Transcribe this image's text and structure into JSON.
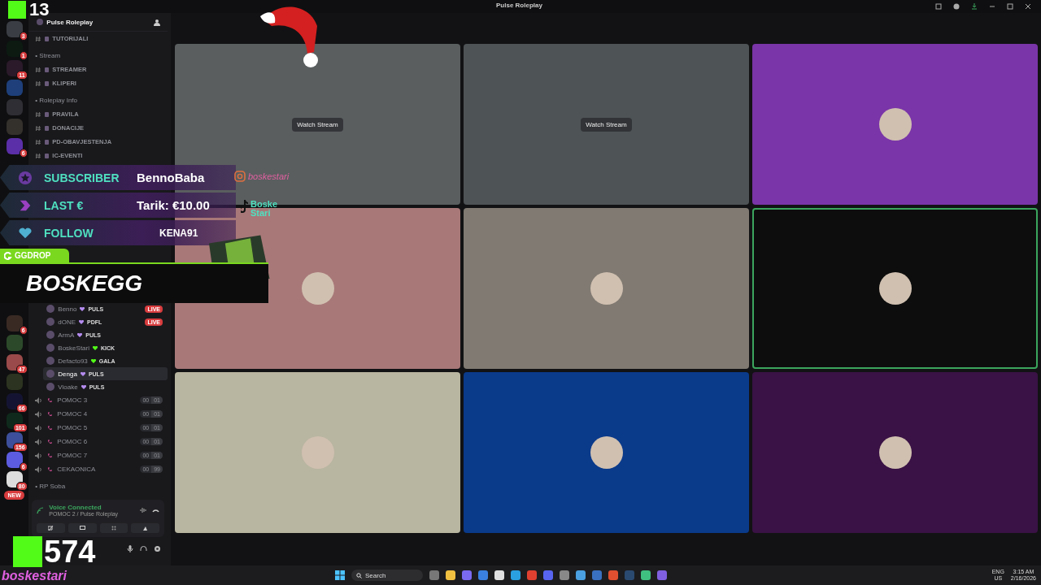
{
  "window": {
    "title": "Pulse Roleplay"
  },
  "server_rail": {
    "top": [
      {
        "color": "#3a3d44",
        "badge": "3"
      },
      {
        "color": "#0c1a12",
        "badge": "1"
      },
      {
        "color": "#2a1a2a",
        "badge": "11"
      },
      {
        "color": "#1e3f7a"
      },
      {
        "color": "#2e2e34"
      },
      {
        "color": "#34302c"
      },
      {
        "color": "#5b2fa8",
        "badge": "6"
      }
    ],
    "bottom": [
      {
        "color": "#3a2a24",
        "badge": "6"
      },
      {
        "color": "#2c4a2a"
      },
      {
        "color": "#9a4a4a",
        "badge": "47"
      },
      {
        "color": "#2c3320"
      },
      {
        "color": "#141432",
        "badge": "66"
      },
      {
        "color": "#0f2a1c",
        "badge": "101"
      },
      {
        "color": "#3d4f9a",
        "badge": "156"
      },
      {
        "color": "#5c5ce0",
        "badge": "6"
      },
      {
        "color": "#dddddd",
        "badge": "80"
      }
    ],
    "new_label": "NEW"
  },
  "sidebar": {
    "server_name": "Pulse Roleplay",
    "channels": [
      {
        "kind": "channel",
        "name": "TUTORIJALI"
      },
      {
        "kind": "category",
        "name": "• Stream"
      },
      {
        "kind": "channel",
        "name": "STREAMER"
      },
      {
        "kind": "channel",
        "name": "KLIPERI"
      },
      {
        "kind": "category",
        "name": "• Roleplay Info"
      },
      {
        "kind": "channel",
        "name": "PRAVILA"
      },
      {
        "kind": "channel",
        "name": "DONACIJE"
      },
      {
        "kind": "channel",
        "name": "PD-OBAVJESTENJA"
      },
      {
        "kind": "channel",
        "name": "IC-EVENTI"
      }
    ],
    "voice_users": [
      {
        "name": "Benno",
        "tag": "PULS",
        "color": "#b58cf0",
        "live_badge": "LIVE",
        "selected": false
      },
      {
        "name": "dONE",
        "tag": "PDFL",
        "color": "#b58cf0",
        "live_badge": "LIVE",
        "selected": false
      },
      {
        "name": "ArmA",
        "tag": "PULS",
        "color": "#b58cf0",
        "selected": false
      },
      {
        "name": "BoskeStari",
        "tag": "KICK",
        "color": "#53fc18",
        "selected": false
      },
      {
        "name": "Defacto93",
        "tag": "GALA",
        "color": "#53fc18",
        "selected": false
      },
      {
        "name": "Denga",
        "tag": "PULS",
        "color": "#b58cf0",
        "selected": true
      },
      {
        "name": "Vioake",
        "tag": "PULS",
        "color": "#b58cf0",
        "selected": false
      }
    ],
    "voice_channels": [
      {
        "name": "POMOC 3",
        "count": "00",
        "limit": "01"
      },
      {
        "name": "POMOC 4",
        "count": "00",
        "limit": "01"
      },
      {
        "name": "POMOC 5",
        "count": "00",
        "limit": "01"
      },
      {
        "name": "POMOC 6",
        "count": "00",
        "limit": "01"
      },
      {
        "name": "POMOC 7",
        "count": "00",
        "limit": "01"
      },
      {
        "name": "CEKAONICA",
        "count": "00",
        "limit": "99"
      }
    ],
    "last_category": "• RP Soba",
    "voice_panel": {
      "status": "Voice Connected",
      "location": "POMOC 2 / Pulse Roleplay"
    }
  },
  "tiles": [
    {
      "kind": "stream",
      "label": "Watch Stream",
      "color": "#5a5e5f",
      "speaking": false
    },
    {
      "kind": "stream",
      "label": "Watch Stream",
      "color": "#4e5355",
      "speaking": false
    },
    {
      "kind": "avatar",
      "color": "#7a35a8",
      "speaking": false
    },
    {
      "kind": "avatar",
      "color": "#a87878",
      "speaking": false
    },
    {
      "kind": "avatar",
      "color": "#807a72",
      "speaking": false
    },
    {
      "kind": "avatar",
      "color": "#0d0d0d",
      "speaking": true
    },
    {
      "kind": "avatar",
      "color": "#b8b5a0",
      "speaking": false
    },
    {
      "kind": "avatar",
      "color": "#0a3a8a",
      "speaking": false
    },
    {
      "kind": "avatar",
      "color": "#3a1245",
      "speaking": false
    }
  ],
  "stream_overlay": {
    "viewers": "13",
    "followers": "574",
    "channel_name": "boskestari",
    "alerts": [
      {
        "kind": "subscriber",
        "label": "SUBSCRIBER",
        "value": "BennoBaba"
      },
      {
        "kind": "donation",
        "label": "LAST €",
        "value": "Tarik: €10.00"
      },
      {
        "kind": "follow",
        "label": "FOLLOW",
        "value": "KENA91"
      }
    ],
    "instagram": "boskestari",
    "tiktok": "Boske Stari",
    "sponsor": {
      "brand": "GGDROP",
      "code": "BOSKEGG"
    }
  },
  "taskbar": {
    "search": "Search",
    "language": "ENG",
    "region": "US",
    "time": "3:15 AM",
    "date": "2/16/2026"
  }
}
